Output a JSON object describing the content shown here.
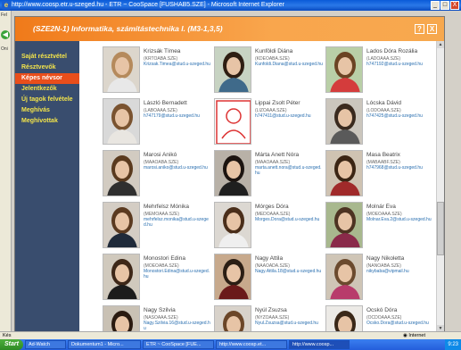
{
  "window": {
    "title": "http://www.coosp.etr.u-szeged.hu - ETR ~ CooSpace [FUSHAB5.SZE] - Microsoft Internet Explorer",
    "min": "_",
    "max": "□",
    "close": "X"
  },
  "strip": {
    "fav": "Fel",
    "hint": "Oni"
  },
  "popup": {
    "title": "(SZE2N-1) Informatika, számítástechnika I. (M3-1,3,5)",
    "help": "?",
    "close": "X"
  },
  "menu": {
    "items": [
      {
        "label": "Saját résztvétel",
        "active": false
      },
      {
        "label": "Résztvevők",
        "active": false
      },
      {
        "label": "Képes névsor",
        "active": true
      },
      {
        "label": "Jelentkezők",
        "active": false
      },
      {
        "label": "Új tagok felvétele",
        "active": false
      },
      {
        "label": "Meghívás",
        "active": false
      },
      {
        "label": "Meghívottak",
        "active": false
      }
    ]
  },
  "people": [
    {
      "name": "Krizsák Tímea",
      "id": "(KRTOABA.SZE)",
      "email": "Krizsak.Timea@stud.u-szeged.hu",
      "hair": "#b58a5c",
      "shirt": "#e8e8e8",
      "bg": "#dcd6cc"
    },
    {
      "name": "Kunföldi Diána",
      "id": "(KDEOABA.SZE)",
      "email": "Kunfoldi.Diana@stud.u-szeged.hu",
      "hair": "#2e1e12",
      "shirt": "#3f6a8a",
      "bg": "#c7d3c2"
    },
    {
      "name": "Lados Dóra Rozália",
      "id": "(LADOAAA.SZE)",
      "email": "h747192@stud.u-szeged.hu",
      "hair": "#6b4323",
      "shirt": "#d43c3c",
      "bg": "#b9cfa7"
    },
    {
      "name": "László Bernadett",
      "id": "(LABOAAA.SZE)",
      "email": "h747179@stud.u-szeged.hu",
      "hair": "#7a5330",
      "shirt": "#e9e6e1",
      "bg": "#d9d9d9"
    },
    {
      "name": "Lippai Zsolt Péter",
      "id": "(LIZOAAA.SZE)",
      "email": "h747411@stud.u-szeged.hu",
      "hair": "",
      "shirt": "",
      "bg": ""
    },
    {
      "name": "Lócska Dávid",
      "id": "(LODOAAA.SZE)",
      "email": "h747425@stud.u-szeged.hu",
      "hair": "#3a2a1e",
      "shirt": "#5a5a5a",
      "bg": "#cbc6bd"
    },
    {
      "name": "Marosi Anikó",
      "id": "(MAAOABA.SZE)",
      "email": "marosi.aniko@stud.u-szeged.hu",
      "hair": "#5a3a1e",
      "shirt": "#2f2f2f",
      "bg": "#d2cbc1"
    },
    {
      "name": "Márta Anett Nóra",
      "id": "(MAAOAAA.SZE)",
      "email": "marta.anett.nora@stud.u-szeged.hu",
      "hair": "#1c1410",
      "shirt": "#1f1f1f",
      "bg": "#b8b1a7"
    },
    {
      "name": "Masa Beatrix",
      "id": "(MABAABF.SZE)",
      "email": "h747968@stud.u-szeged.hu",
      "hair": "#3b2514",
      "shirt": "#a02a2a",
      "bg": "#cfc3b2"
    },
    {
      "name": "Mehrfelsz Mónika",
      "id": "(MEMOAAA.SZE)",
      "email": "mehrfelsz.monika@stud.u-szeged.hu",
      "hair": "#5b3a20",
      "shirt": "#1f2a3a",
      "bg": "#d4cdc4"
    },
    {
      "name": "Mórges Dóra",
      "id": "(MEDOAAA.SZE)",
      "email": "Morges.Dora@stud.u-szeged.hu",
      "hair": "#4a2e1a",
      "shirt": "#efefef",
      "bg": "#dcd8d2"
    },
    {
      "name": "Molnár Éva",
      "id": "(MOEOAAA.SZE)",
      "email": "Molnar.Eva.2@stud.u-szeged.hu",
      "hair": "#4d3322",
      "shirt": "#8a2a4a",
      "bg": "#a8b88e"
    },
    {
      "name": "Monostori Edina",
      "id": "(MOEOABA.SZE)",
      "email": "Monostori.Edina@stud.u-szeged.hu",
      "hair": "#3d2718",
      "shirt": "#1c1c1c",
      "bg": "#d0c9bd"
    },
    {
      "name": "Nagy Attila",
      "id": "(NAAOADA.SZE)",
      "email": "Nagy.Attila.18@stud.u-szeged.hu",
      "hair": "#2b1e14",
      "shirt": "#6a1a1a",
      "bg": "#c7a98c"
    },
    {
      "name": "Nagy Nikoletta",
      "id": "(NANOABA.SZE)",
      "email": "nikybaba@vipmail.hu",
      "hair": "#6b4a2e",
      "shirt": "#b83b6b",
      "bg": "#cfc5b6"
    },
    {
      "name": "Nagy Szilvia",
      "id": "(NASOAAA.SZE)",
      "email": "Nagy.Szilvia.16@stud.u-szeged.hu",
      "hair": "#2a1a10",
      "shirt": "#2a2a2a",
      "bg": "#c9c1b4"
    },
    {
      "name": "Nyúl Zsuzsa",
      "id": "(NYZOAAA.SZE)",
      "email": "Nyul.Zsuzsa@stud.u-szeged.hu",
      "hair": "#6b4628",
      "shirt": "#e4e4e4",
      "bg": "#d8d2ca"
    },
    {
      "name": "Ocskó Dóra",
      "id": "(OCDOAAA.SZE)",
      "email": "Ocsko.Dora@stud.u-szeged.hu",
      "hair": "#3a2818",
      "shirt": "#cfcfcf",
      "bg": "#eceae6"
    }
  ],
  "statusbar": {
    "left": "Kés",
    "zone": "Internet"
  },
  "taskbar": {
    "start": "Start",
    "items": [
      {
        "label": "Ad-Watch"
      },
      {
        "label": "Dokumentum1 - Micro..."
      },
      {
        "label": "ETR ~ CooSpace [FUE..."
      },
      {
        "label": "http://www.coosp.et..."
      },
      {
        "label": "http://www.coosp..."
      }
    ],
    "clock": "9:23"
  }
}
